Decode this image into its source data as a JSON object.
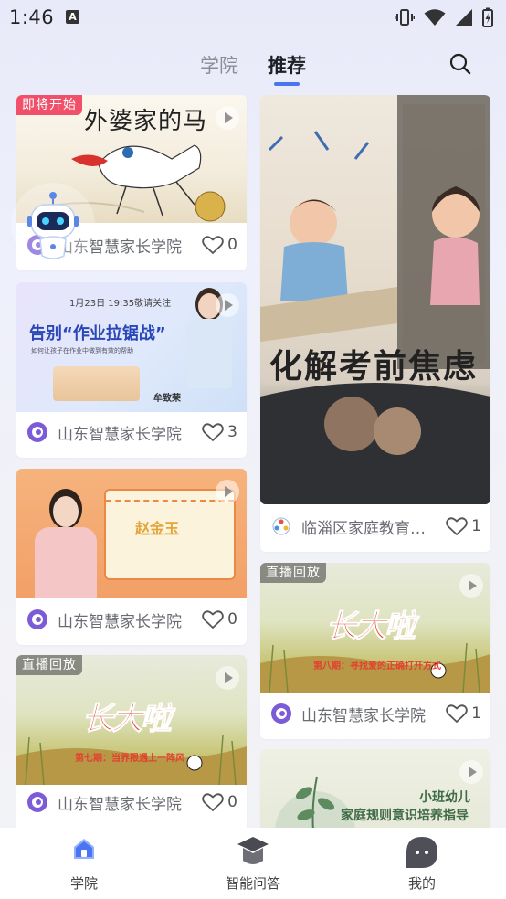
{
  "status_bar": {
    "time": "1:46",
    "notification_letter": "A"
  },
  "tabs": {
    "college": "学院",
    "recommend": "推荐"
  },
  "left_column": [
    {
      "badge": "即将开始",
      "thumb_title": "外婆家的马",
      "author": "山东智慧家长学院",
      "likes": "0"
    },
    {
      "thumb_date": "1月23日 19:35敬请关注",
      "thumb_title": "告别“作业拉锯战”",
      "thumb_subtitle": "如何让孩子在作业中做到有效的帮助",
      "thumb_speaker": "牟致荣",
      "author": "山东智慧家长学院",
      "likes": "3"
    },
    {
      "thumb_name": "赵金玉",
      "author": "山东智慧家长学院",
      "likes": "0"
    },
    {
      "badge": "直播回放",
      "thumb_title": "长大啦",
      "thumb_subtitle": "第七期：当界限遇上一阵风",
      "author": "山东智慧家长学院",
      "likes": "0"
    }
  ],
  "right_column": [
    {
      "thumb_title": "化解考前焦虑",
      "author": "临淄区家庭教育…",
      "likes": "1"
    },
    {
      "badge": "直播回放",
      "thumb_title": "长大啦",
      "thumb_subtitle": "第八期：寻找爱的正确打开方式",
      "author": "山东智慧家长学院",
      "likes": "1"
    },
    {
      "thumb_line1": "小班幼儿",
      "thumb_line2": "家庭规则意识培养指导"
    }
  ],
  "bottom_nav": [
    {
      "label": "学院",
      "active": true
    },
    {
      "label": "智能问答",
      "active": false
    },
    {
      "label": "我的",
      "active": false
    }
  ],
  "colors": {
    "accent": "#4b74f3",
    "badge_soon": "#f0506a"
  }
}
